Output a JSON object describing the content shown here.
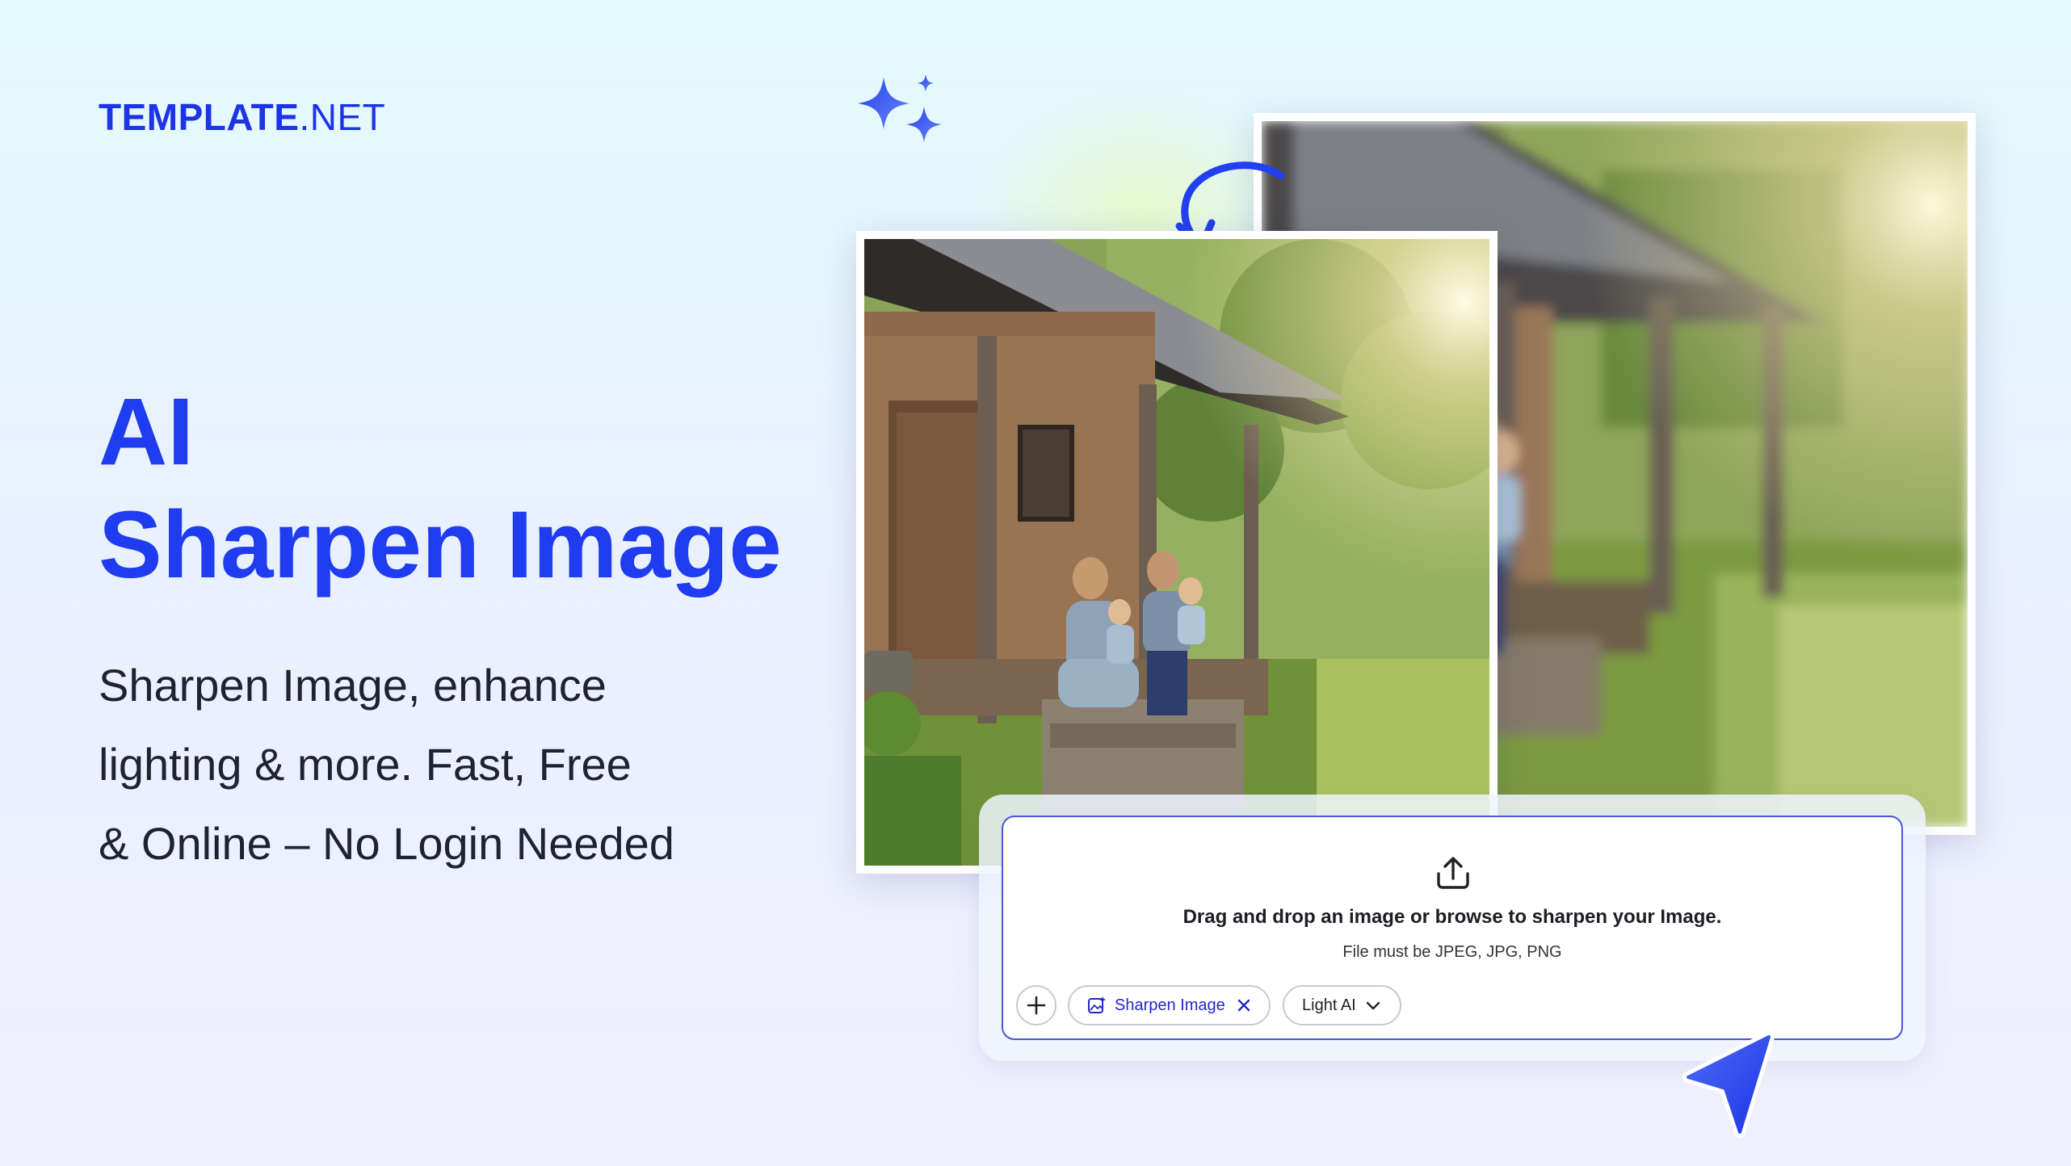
{
  "brand": {
    "bold": "TEMPLATE",
    "normal": ".NET"
  },
  "hero": {
    "title_line1": "AI",
    "title_line2": "Sharpen Image",
    "desc_line1": "Sharpen Image, enhance",
    "desc_line2": "lighting & more. Fast, Free",
    "desc_line3": "& Online – No Login Needed"
  },
  "images": {
    "after_icon": "sharp-family-photo",
    "before_icon": "blurry-family-photo"
  },
  "upload": {
    "icon": "upload-icon",
    "drag_text": "Drag and drop an image or browse to sharpen your Image.",
    "file_text": "File must be JPEG, JPG, PNG"
  },
  "toolbar": {
    "add_icon": "plus-icon",
    "chip_sharpen": "Sharpen Image",
    "chip_sharpen_icon": "image-sparkle-icon",
    "chip_remove_icon": "close-icon",
    "chip_light": "Light AI",
    "chip_light_icon": "chevron-down-icon"
  },
  "colors": {
    "brand_blue": "#1f3cf0",
    "text_dark": "#1f2230",
    "accent_border": "#4a55d8"
  }
}
